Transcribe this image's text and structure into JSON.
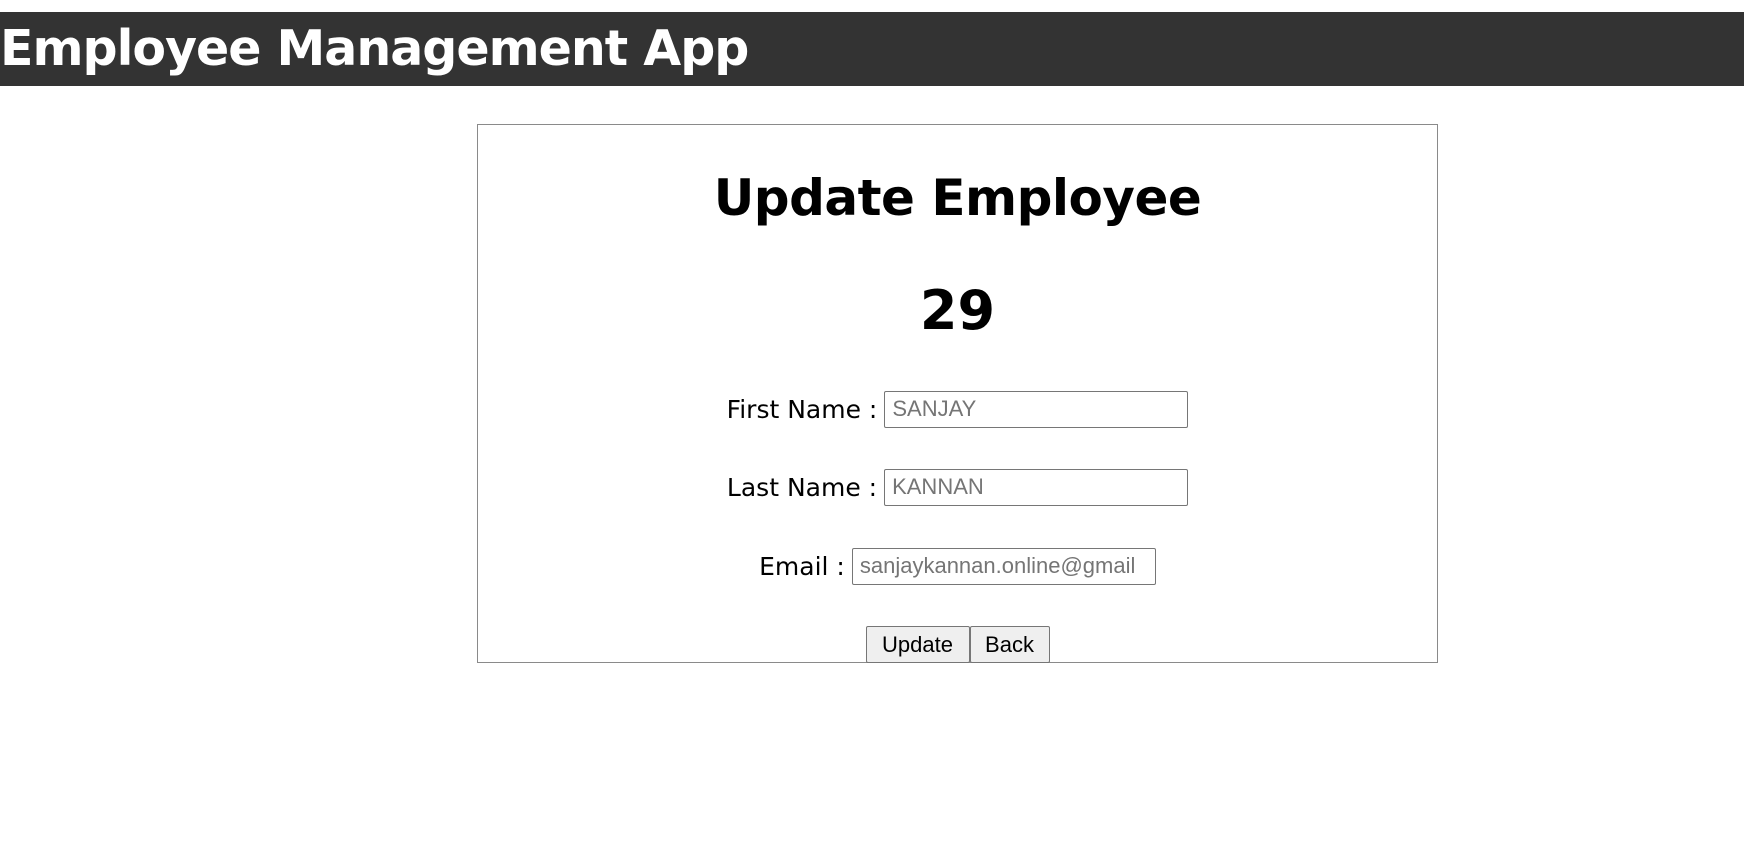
{
  "header": {
    "title": "Employee Management App",
    "background_color": "#333333",
    "text_color": "#ffffff"
  },
  "form": {
    "heading": "Update Employee",
    "employee_id": "29",
    "fields": [
      {
        "label": "First Name :",
        "placeholder": "SANJAY",
        "value": ""
      },
      {
        "label": "Last Name :",
        "placeholder": "KANNAN",
        "value": ""
      },
      {
        "label": "Email :",
        "placeholder": "sanjaykannan.online@gmail",
        "value": ""
      }
    ],
    "buttons": {
      "update_label": "Update",
      "back_label": "Back"
    }
  }
}
